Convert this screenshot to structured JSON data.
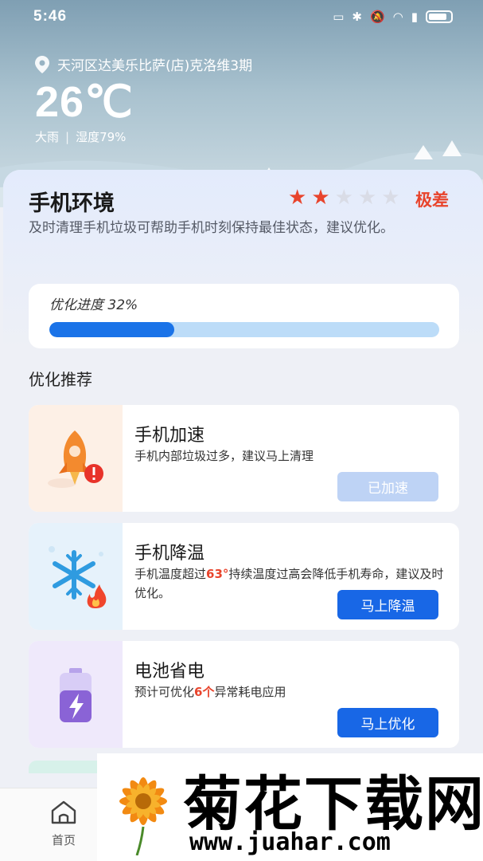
{
  "status_bar": {
    "time": "5:46",
    "icons": [
      "cast-icon",
      "bluetooth-icon",
      "mute-icon",
      "wifi-icon",
      "alert-icon",
      "battery-icon"
    ]
  },
  "weather": {
    "location": "天河区达美乐比萨(店)克洛维3期",
    "temperature": "26℃",
    "condition": "大雨",
    "separator": "|",
    "humidity": "湿度79%"
  },
  "phone_env": {
    "title": "手机环境",
    "rating_stars": 2,
    "rating_max": 5,
    "rating_text": "极差",
    "description": "及时清理手机垃圾可帮助手机时刻保持最佳状态，建议优化。"
  },
  "progress": {
    "label": "优化进度 32%",
    "value": 0.32
  },
  "recommend": {
    "title": "优化推荐",
    "items": [
      {
        "title": "手机加速",
        "desc": "手机内部垃圾过多，建议马上清理",
        "button": "已加速",
        "icon": "rocket-icon",
        "bg": "#fdf0e6"
      },
      {
        "title": "手机降温",
        "desc_before": "手机温度超过",
        "desc_highlight": "63°",
        "desc_after": "持续温度过高会降低手机寿命，建议及时优化。",
        "button": "马上降温",
        "icon": "snowflake-icon",
        "bg": "#e6f2fb"
      },
      {
        "title": "电池省电",
        "desc_before": "预计可优化",
        "desc_highlight": "6个",
        "desc_after": "异常耗电应用",
        "button": "马上优化",
        "icon": "battery-charge-icon",
        "bg": "#efe9fb"
      }
    ]
  },
  "bottom_nav": {
    "home_label": "首页"
  },
  "watermark": {
    "text": "菊花下载网",
    "url": "www.juahar.com"
  },
  "colors": {
    "accent": "#1867e6",
    "warning": "#e8442c",
    "progress_track": "#bcdcf8"
  }
}
